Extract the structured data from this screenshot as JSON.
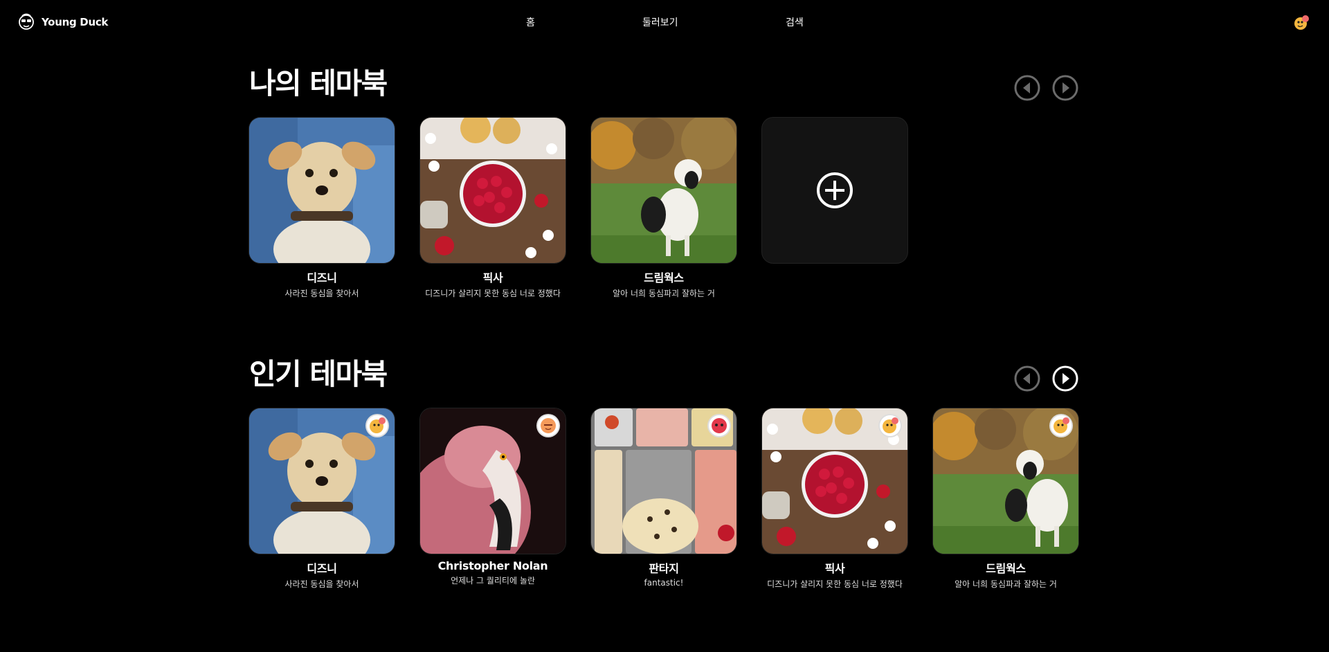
{
  "header": {
    "brand": "Young Duck",
    "nav": [
      "홈",
      "둘러보기",
      "검색"
    ]
  },
  "my_themebooks": {
    "title": "나의 테마북",
    "items": [
      {
        "title": "디즈니",
        "subtitle": "사라진 동심을 찾아서",
        "image": "dog-photo"
      },
      {
        "title": "픽사",
        "subtitle": "디즈니가 살리지 못한 동심 너로 정했다",
        "image": "raspberries-photo"
      },
      {
        "title": "드림웍스",
        "subtitle": "알아 너희 동심파괴 잘하는 거",
        "image": "lamb-photo"
      }
    ],
    "add_icon": "plus-circle-icon"
  },
  "popular_themebooks": {
    "title": "인기 테마북",
    "items": [
      {
        "title": "디즈니",
        "subtitle": "사라진 동심을 찾아서",
        "image": "dog-photo"
      },
      {
        "title": "Christopher Nolan",
        "subtitle": "언제나 그 퀄리티에 놀란",
        "image": "flamingo-photo"
      },
      {
        "title": "판타지",
        "subtitle": "fantastic!",
        "image": "ice-cream-photo"
      },
      {
        "title": "픽사",
        "subtitle": "디즈니가 살리지 못한 동심 너로 정했다",
        "image": "raspberries-photo"
      },
      {
        "title": "드림웍스",
        "subtitle": "알아 너희 동심파과 잘하는 거",
        "image": "lamb-photo"
      }
    ]
  },
  "colors": {
    "background": "#000000",
    "card_placeholder": "#131313",
    "arrow_disabled": "#6b6b6b",
    "arrow_active": "#ffffff"
  }
}
